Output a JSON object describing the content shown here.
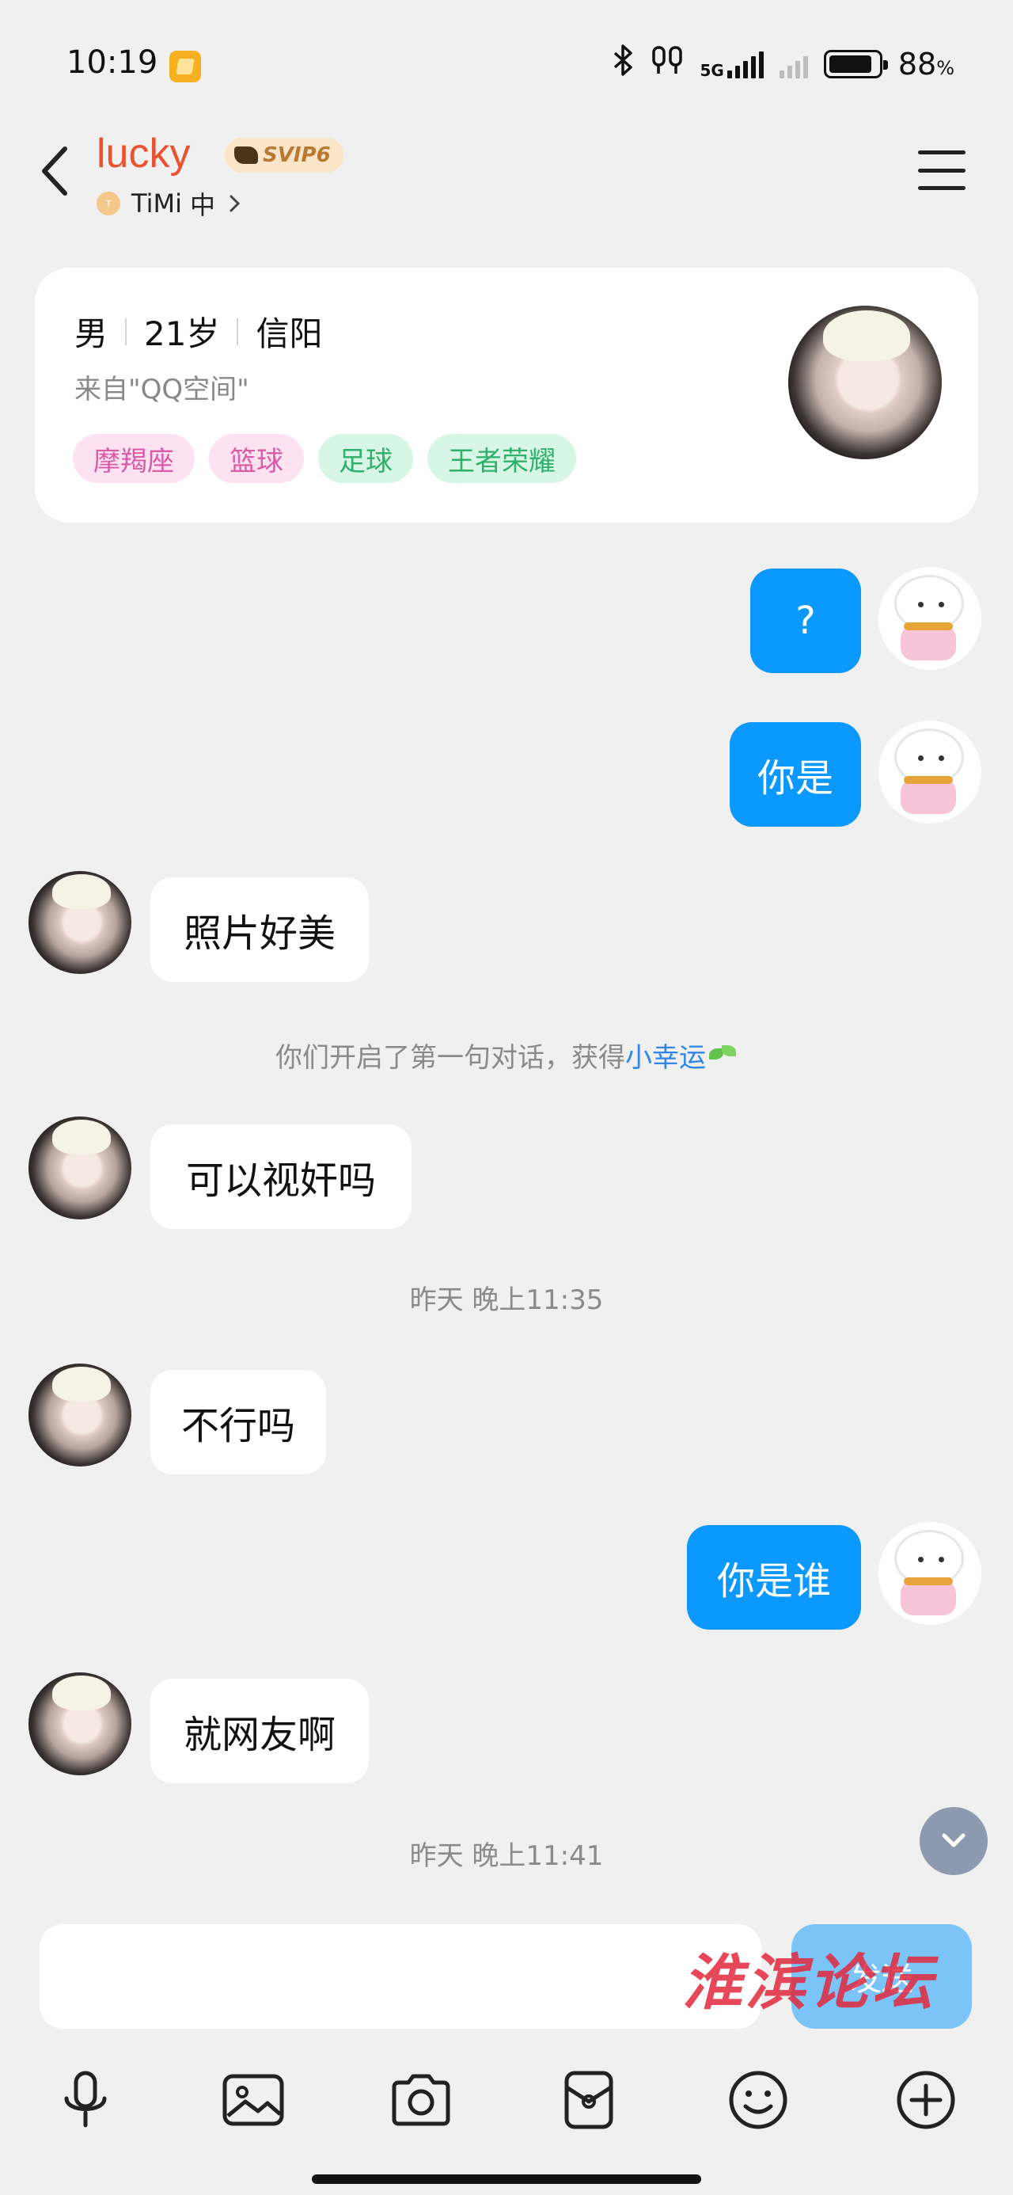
{
  "status_bar": {
    "time": "10:19",
    "network": "5G",
    "battery": "88",
    "battery_unit": "%",
    "battery_level": 0.88
  },
  "header": {
    "contact_name": "lucky",
    "vip_badge": "SVIP6",
    "game_label": "TiMi",
    "status": "中"
  },
  "profile": {
    "gender": "男",
    "age": "21岁",
    "city": "信阳",
    "source": "来自\"QQ空间\"",
    "tags": [
      {
        "label": "摩羯座",
        "color": "#db5aa6"
      },
      {
        "label": "篮球",
        "color": "#db5aa6"
      },
      {
        "label": "足球",
        "color": "#2fb06c"
      },
      {
        "label": "王者荣耀",
        "color": "#2fb06c"
      }
    ]
  },
  "messages": [
    {
      "text": "?",
      "direction": "outgoing"
    },
    {
      "text": "你是",
      "direction": "outgoing"
    },
    {
      "text": "照片好美",
      "direction": "incoming"
    },
    {
      "text": "可以视奸吗",
      "direction": "incoming"
    },
    {
      "text": "不行吗",
      "direction": "incoming"
    },
    {
      "text": "你是谁",
      "direction": "outgoing"
    },
    {
      "text": "就网友啊",
      "direction": "incoming"
    }
  ],
  "system": {
    "first_chat_prefix": "你们开启了第一句对话，获得",
    "first_chat_highlight": "小幸运",
    "timestamp_1": "昨天 晚上11:35",
    "timestamp_2": "昨天 晚上11:41"
  },
  "input": {
    "placeholder": "",
    "send_label": "发送"
  },
  "watermark": "淮滨论坛",
  "colors": {
    "accent": "#0b99ff",
    "name": "#e9532f",
    "background": "#f0f0f0"
  },
  "toolbar_icons": [
    "microphone-icon",
    "image-icon",
    "camera-icon",
    "red-packet-icon",
    "emoji-icon",
    "plus-icon"
  ]
}
